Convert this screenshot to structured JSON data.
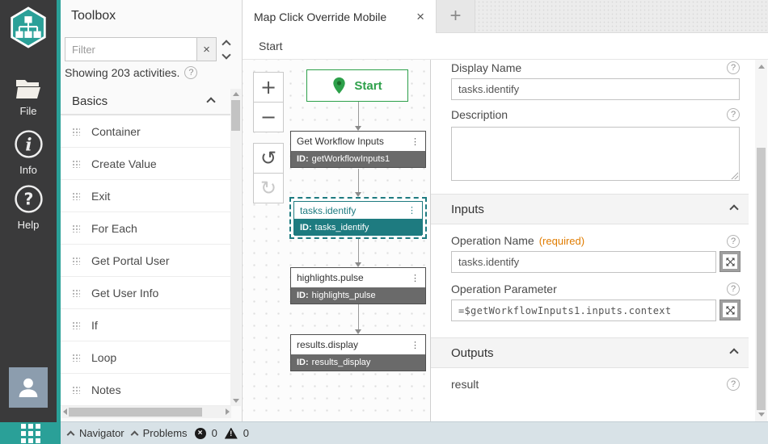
{
  "icons": {
    "help": "?",
    "menu": "⋮",
    "close": "×",
    "zoom_in": "+",
    "zoom_out": "−",
    "undo": "↺",
    "redo": "↻",
    "new_tab": "+"
  },
  "colors": {
    "brand_teal": "#2aa098",
    "selection_teal": "#1e7b80",
    "start_green": "#2da04a",
    "required_orange": "#e07c00",
    "node_id_gray": "#6a6a6a"
  },
  "sidebar": {
    "items": [
      {
        "label": "File"
      },
      {
        "label": "Info"
      },
      {
        "label": "Help"
      }
    ]
  },
  "toolbox": {
    "title": "Toolbox",
    "filter_placeholder": "Filter",
    "showing_text": "Showing 203 activities.",
    "sections": [
      {
        "label": "Basics",
        "items": [
          "Container",
          "Create Value",
          "Exit",
          "For Each",
          "Get Portal User",
          "Get User Info",
          "If",
          "Loop",
          "Notes"
        ]
      }
    ]
  },
  "tabs": {
    "active_title": "Map Click Override Mobile"
  },
  "breadcrumb": {
    "current": "Start"
  },
  "canvas": {
    "start_label": "Start",
    "nodes": [
      {
        "title": "Get Workflow Inputs",
        "id_label": "ID:",
        "id": "getWorkflowInputs1"
      },
      {
        "title": "tasks.identify",
        "id_label": "ID:",
        "id": "tasks_identify",
        "selected": true
      },
      {
        "title": "highlights.pulse",
        "id_label": "ID:",
        "id": "highlights_pulse"
      },
      {
        "title": "results.display",
        "id_label": "ID:",
        "id": "results_display"
      }
    ]
  },
  "properties": {
    "display_name": {
      "label": "Display Name",
      "value": "tasks.identify"
    },
    "description": {
      "label": "Description",
      "value": ""
    },
    "inputs": {
      "header": "Inputs",
      "operation_name": {
        "label": "Operation Name",
        "required": "(required)",
        "value": "tasks.identify"
      },
      "operation_parameter": {
        "label": "Operation Parameter",
        "value": "=$getWorkflowInputs1.inputs.context"
      }
    },
    "outputs": {
      "header": "Outputs",
      "items": [
        "result"
      ]
    }
  },
  "statusbar": {
    "navigator_label": "Navigator",
    "problems_label": "Problems",
    "error_count": "0",
    "warning_count": "0"
  }
}
